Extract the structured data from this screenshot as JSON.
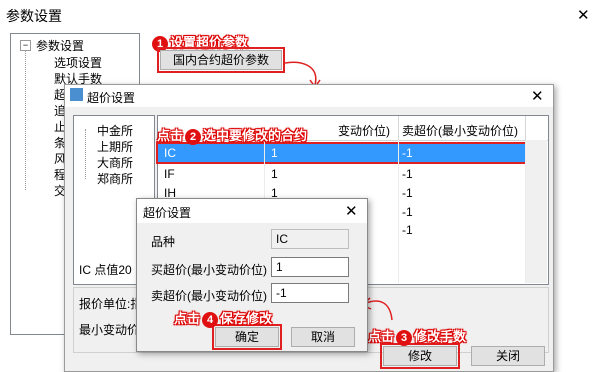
{
  "main": {
    "title": "参数设置",
    "close": "✕",
    "tree_root": "参数设置",
    "tree_items": [
      "选项设置",
      "默认手数",
      "超",
      "追",
      "止",
      "条",
      "风",
      "程",
      "交"
    ],
    "domestic_button": "国内合约超价参数"
  },
  "annotations": {
    "step1": {
      "num": "1",
      "text": "设置超价参数"
    },
    "step2": {
      "prefix": "点击",
      "num": "2",
      "text": "选中要修改的合约"
    },
    "step3": {
      "prefix": "点击",
      "num": "3",
      "text": "修改手数"
    },
    "step4": {
      "prefix": "点击",
      "num": "4",
      "text": "保存修改"
    }
  },
  "overprice": {
    "title": "超价设置",
    "close": "✕",
    "exchanges": [
      "中金所",
      "上期所",
      "大商所",
      "郑商所"
    ],
    "col_buy_partial": "变动价位)",
    "col_sell": "卖超价(最小变动价位)",
    "rows": [
      {
        "code": "IC",
        "buy": "1",
        "sell": "-1",
        "selected": true
      },
      {
        "code": "IF",
        "buy": "1",
        "sell": "-1",
        "selected": false
      },
      {
        "code": "IH",
        "buy": "1",
        "sell": "-1",
        "selected": false
      },
      {
        "code": "",
        "buy": "",
        "sell": "-1",
        "selected": false
      },
      {
        "code": "",
        "buy": "",
        "sell": "-1",
        "selected": false
      }
    ],
    "info_line1": "IC  点值20",
    "info_unit": "报价单位:指",
    "info_min": "最小变动价",
    "modify": "修改",
    "close_btn": "关闭"
  },
  "editor": {
    "title": "超价设置",
    "close": "✕",
    "variety_label": "品种",
    "variety_value": "IC",
    "buy_label": "买超价(最小变动价位)",
    "buy_value": "1",
    "sell_label": "卖超价(最小变动价位)",
    "sell_value": "-1",
    "ok": "确定",
    "cancel": "取消"
  }
}
